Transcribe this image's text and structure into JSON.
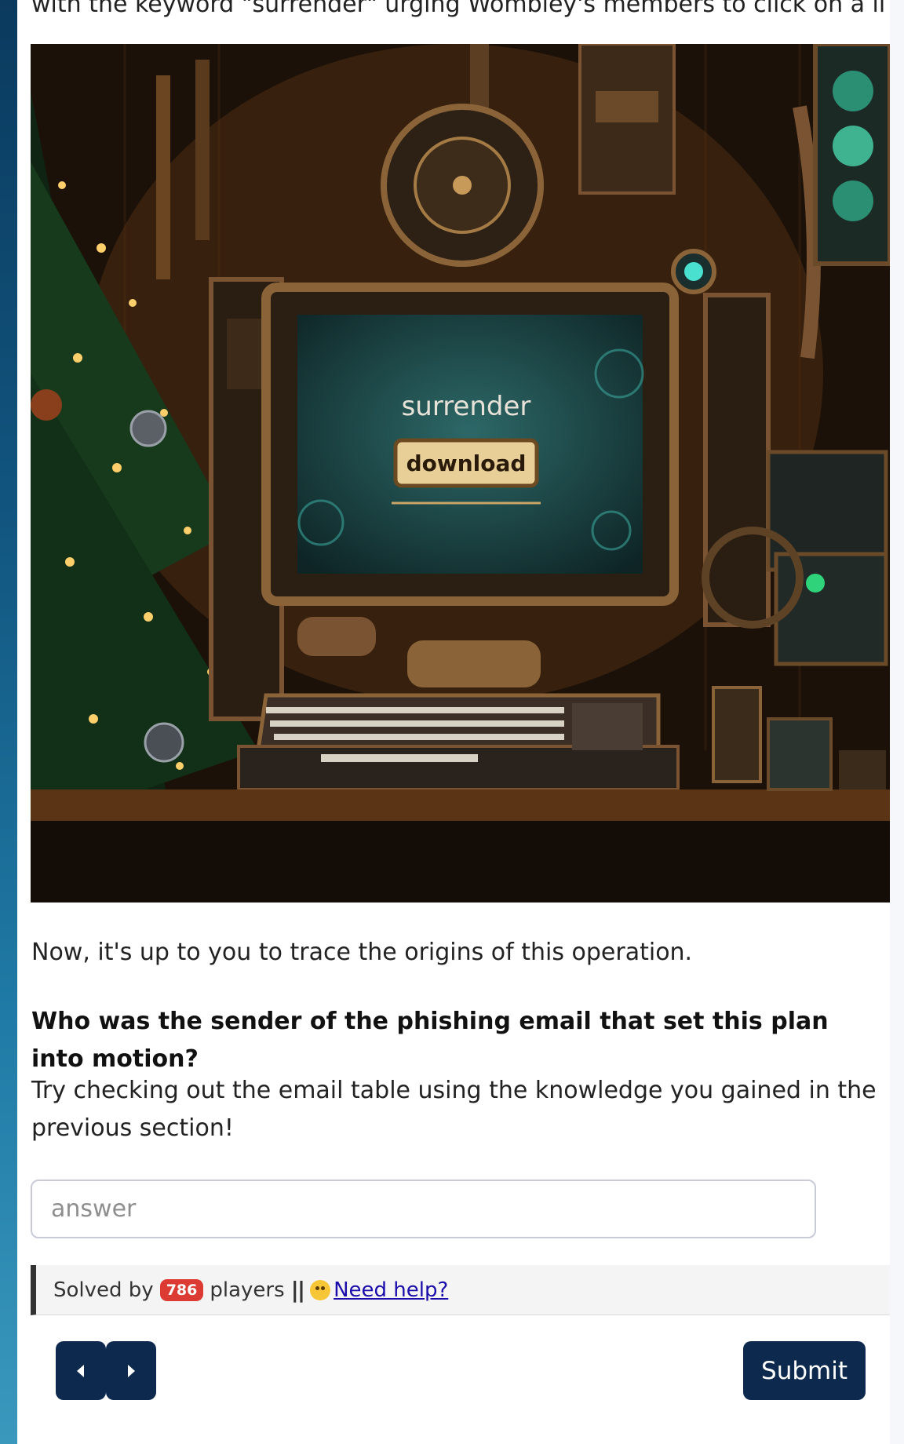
{
  "top_text": "with the keyword \"surrender\" urging Wombley's members to click on a link.",
  "scene": {
    "screen_title": "surrender",
    "screen_button": "download"
  },
  "content": {
    "intro": "Now, it's up to you to trace the origins of this operation.",
    "question": "Who was the sender of the phishing email that set this plan into motion?",
    "hint": "Try checking out the email table using the knowledge you gained in the previous section!"
  },
  "answer": {
    "placeholder": "answer",
    "value": ""
  },
  "solved": {
    "prefix": "Solved by",
    "count": "786",
    "suffix": "players",
    "separator": "||",
    "help_label": "Need help?"
  },
  "buttons": {
    "submit": "Submit",
    "prev_icon": "caret-left-icon",
    "next_icon": "caret-right-icon"
  },
  "colors": {
    "accent": "#0d2a4e",
    "badge": "#dc3b33",
    "link": "#1a0dab",
    "screen": "#1f4a4c"
  }
}
